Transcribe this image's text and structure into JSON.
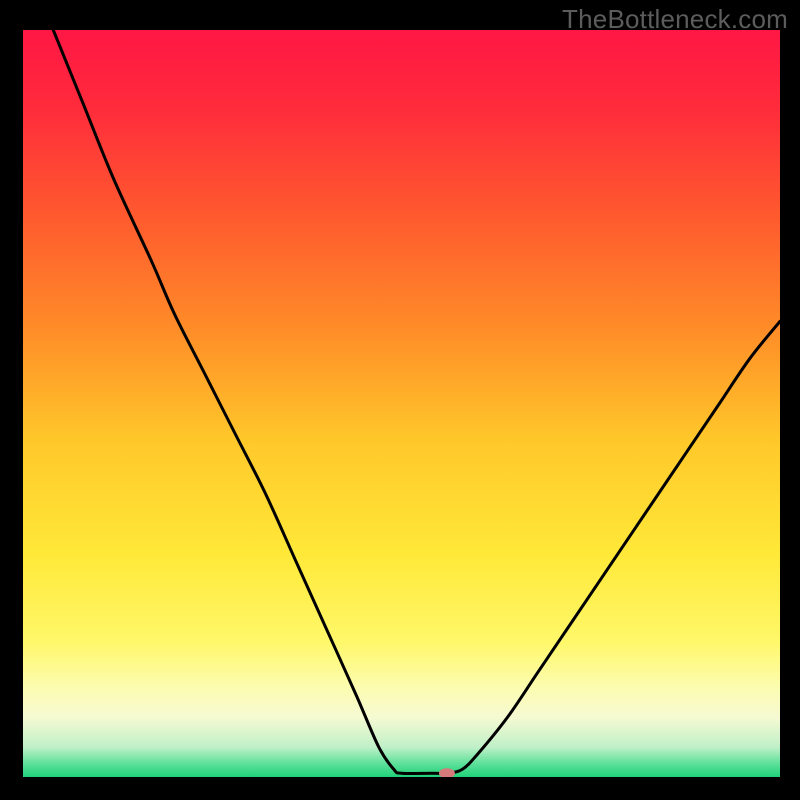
{
  "watermark": "TheBottleneck.com",
  "chart_data": {
    "type": "line",
    "title": "",
    "xlabel": "",
    "ylabel": "",
    "xlim": [
      0,
      100
    ],
    "ylim": [
      0,
      100
    ],
    "grid": false,
    "gradient_stops": [
      {
        "offset": 0,
        "color": "#ff1744"
      },
      {
        "offset": 10,
        "color": "#ff2a3c"
      },
      {
        "offset": 25,
        "color": "#ff5a2e"
      },
      {
        "offset": 40,
        "color": "#ff8c28"
      },
      {
        "offset": 55,
        "color": "#ffc82a"
      },
      {
        "offset": 70,
        "color": "#ffe838"
      },
      {
        "offset": 82,
        "color": "#fff86a"
      },
      {
        "offset": 88,
        "color": "#fcfcb0"
      },
      {
        "offset": 92,
        "color": "#f6fad2"
      },
      {
        "offset": 96,
        "color": "#c0f0c8"
      },
      {
        "offset": 98,
        "color": "#66e29e"
      },
      {
        "offset": 100,
        "color": "#1ed17a"
      }
    ],
    "series": [
      {
        "name": "bottleneck-curve",
        "color": "#000000",
        "width": 3,
        "points": [
          {
            "x": 4,
            "y": 100
          },
          {
            "x": 8,
            "y": 90
          },
          {
            "x": 12,
            "y": 80
          },
          {
            "x": 17,
            "y": 69
          },
          {
            "x": 20,
            "y": 62
          },
          {
            "x": 24,
            "y": 54
          },
          {
            "x": 28,
            "y": 46
          },
          {
            "x": 32,
            "y": 38
          },
          {
            "x": 36,
            "y": 29
          },
          {
            "x": 40,
            "y": 20
          },
          {
            "x": 44,
            "y": 11
          },
          {
            "x": 47,
            "y": 4
          },
          {
            "x": 49,
            "y": 1
          },
          {
            "x": 50,
            "y": 0.5
          },
          {
            "x": 54,
            "y": 0.5
          },
          {
            "x": 56,
            "y": 0.5
          },
          {
            "x": 58,
            "y": 1
          },
          {
            "x": 60,
            "y": 3
          },
          {
            "x": 64,
            "y": 8
          },
          {
            "x": 68,
            "y": 14
          },
          {
            "x": 72,
            "y": 20
          },
          {
            "x": 76,
            "y": 26
          },
          {
            "x": 80,
            "y": 32
          },
          {
            "x": 84,
            "y": 38
          },
          {
            "x": 88,
            "y": 44
          },
          {
            "x": 92,
            "y": 50
          },
          {
            "x": 96,
            "y": 56
          },
          {
            "x": 100,
            "y": 61
          }
        ]
      }
    ],
    "marker": {
      "x": 56,
      "y": 0.5,
      "color": "#d47a7a",
      "rx": 8,
      "ry": 5
    }
  }
}
